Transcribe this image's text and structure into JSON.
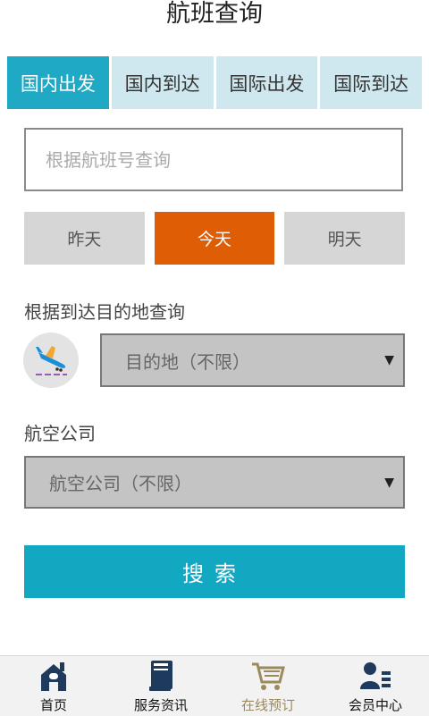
{
  "header": {
    "title": "航班查询"
  },
  "tabs": [
    {
      "label": "国内出发",
      "active": true
    },
    {
      "label": "国内到达",
      "active": false
    },
    {
      "label": "国际出发",
      "active": false
    },
    {
      "label": "国际到达",
      "active": false
    }
  ],
  "flight_search": {
    "placeholder": "根据航班号查询",
    "value": ""
  },
  "days": [
    {
      "label": "昨天",
      "active": false
    },
    {
      "label": "今天",
      "active": true
    },
    {
      "label": "明天",
      "active": false
    }
  ],
  "destination": {
    "label": "根据到达目的地查询",
    "selected": "目的地（不限）",
    "icon": "airplane-landing-icon"
  },
  "airline": {
    "label": "航空公司",
    "selected": "航空公司（不限）"
  },
  "search_button": {
    "label": "搜索"
  },
  "bottom_nav": [
    {
      "label": "首页",
      "icon": "home-icon",
      "active": false
    },
    {
      "label": "服务资讯",
      "icon": "book-icon",
      "active": false
    },
    {
      "label": "在线预订",
      "icon": "cart-icon",
      "active": true
    },
    {
      "label": "会员中心",
      "icon": "member-icon",
      "active": false
    }
  ],
  "colors": {
    "accent": "#1fa9c4",
    "tab_inactive": "#cfe8ef",
    "day_active": "#df5e05",
    "select_bg": "#c4c4c4",
    "nav_active": "#9a8a5e"
  }
}
